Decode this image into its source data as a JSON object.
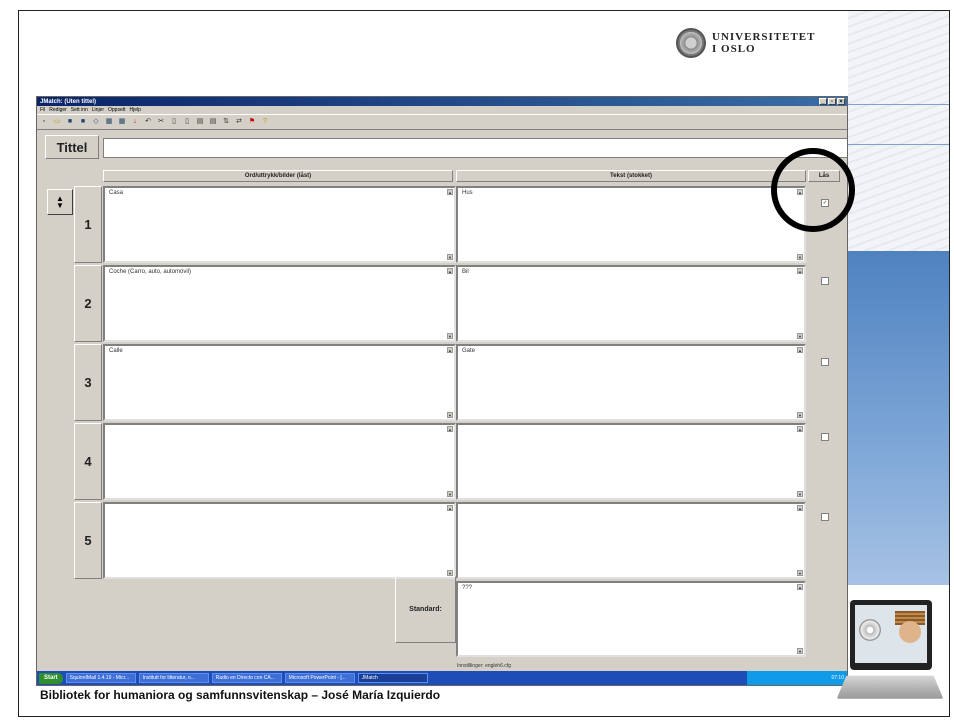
{
  "app": {
    "title": "JMatch: (Uten tittel)",
    "window_buttons": [
      "_",
      "▫",
      "×"
    ],
    "menu": [
      "Fil",
      "Rediger",
      "Sett inn",
      "Linjer",
      "Oppsett",
      "Hjelp"
    ]
  },
  "logo": {
    "line1": "UNIVERSITETET",
    "line2": "I OSLO"
  },
  "form": {
    "tittel_label": "Tittel",
    "tittel_value": "",
    "left_header": "Ord/uttrykk/bilder (låst)",
    "right_header": "Tekst (stokket)",
    "lock_header": "Lås",
    "rows": [
      {
        "num": "1",
        "left": "Casa",
        "right": "Hus",
        "locked": true
      },
      {
        "num": "2",
        "left": "Coche (Carro, auto, automóvil)",
        "right": "Bil",
        "locked": false
      },
      {
        "num": "3",
        "left": "Calle",
        "right": "Gate",
        "locked": false
      },
      {
        "num": "4",
        "left": "",
        "right": "",
        "locked": false
      },
      {
        "num": "5",
        "left": "",
        "right": "",
        "locked": false
      }
    ],
    "standard_label": "Standard:",
    "standard_value": "???"
  },
  "status": {
    "text": "Innstillinger: engleh6.cfg"
  },
  "taskbar": {
    "start": "Start",
    "tasks": [
      "SquirrelMail 1.4.19 - Micr...",
      "Institutt for litteratur, o...",
      "Radio en Directo con CA...",
      "Microsoft PowerPoint - [...",
      "JMatch"
    ],
    "clock": "07:10"
  },
  "footer": {
    "text": "Bibliotek for humaniora og samfunnsvitenskap – José María Izquierdo"
  },
  "colors": {
    "accent_circle": "#000000",
    "titlebar": "#0a246a",
    "taskbar": "#1f4db8"
  }
}
